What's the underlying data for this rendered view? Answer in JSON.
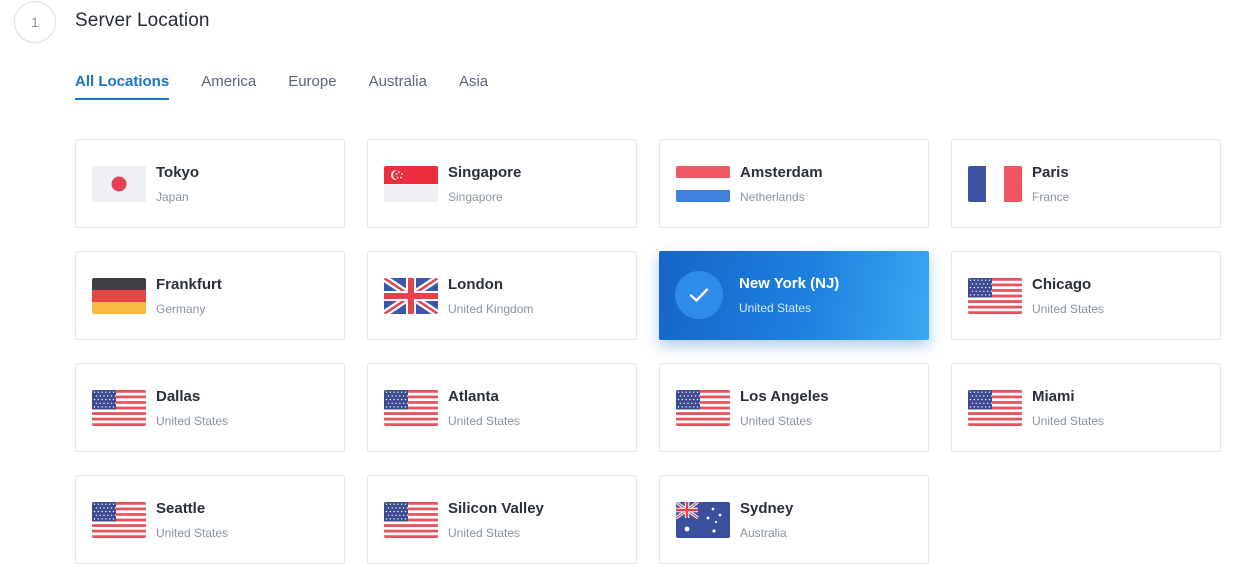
{
  "step": {
    "number": "1",
    "title": "Server Location"
  },
  "tabs": [
    {
      "label": "All Locations",
      "active": true
    },
    {
      "label": "America",
      "active": false
    },
    {
      "label": "Europe",
      "active": false
    },
    {
      "label": "Australia",
      "active": false
    },
    {
      "label": "Asia",
      "active": false
    }
  ],
  "locations": [
    {
      "city": "Tokyo",
      "country": "Japan",
      "flag": "japan-flag-icon"
    },
    {
      "city": "Singapore",
      "country": "Singapore",
      "flag": "singapore-flag-icon"
    },
    {
      "city": "Amsterdam",
      "country": "Netherlands",
      "flag": "netherlands-flag-icon"
    },
    {
      "city": "Paris",
      "country": "France",
      "flag": "france-flag-icon"
    },
    {
      "city": "Frankfurt",
      "country": "Germany",
      "flag": "germany-flag-icon"
    },
    {
      "city": "London",
      "country": "United Kingdom",
      "flag": "uk-flag-icon"
    },
    {
      "city": "New York (NJ)",
      "country": "United States",
      "flag": "check-icon",
      "selected": true
    },
    {
      "city": "Chicago",
      "country": "United States",
      "flag": "usa-flag-icon"
    },
    {
      "city": "Dallas",
      "country": "United States",
      "flag": "usa-flag-icon"
    },
    {
      "city": "Atlanta",
      "country": "United States",
      "flag": "usa-flag-icon"
    },
    {
      "city": "Los Angeles",
      "country": "United States",
      "flag": "usa-flag-icon"
    },
    {
      "city": "Miami",
      "country": "United States",
      "flag": "usa-flag-icon"
    },
    {
      "city": "Seattle",
      "country": "United States",
      "flag": "usa-flag-icon"
    },
    {
      "city": "Silicon Valley",
      "country": "United States",
      "flag": "usa-flag-icon"
    },
    {
      "city": "Sydney",
      "country": "Australia",
      "flag": "australia-flag-icon"
    }
  ],
  "colors": {
    "accent": "#1a73c9",
    "selected_gradient_start": "#1565c8",
    "selected_gradient_end": "#3aa9f2"
  }
}
